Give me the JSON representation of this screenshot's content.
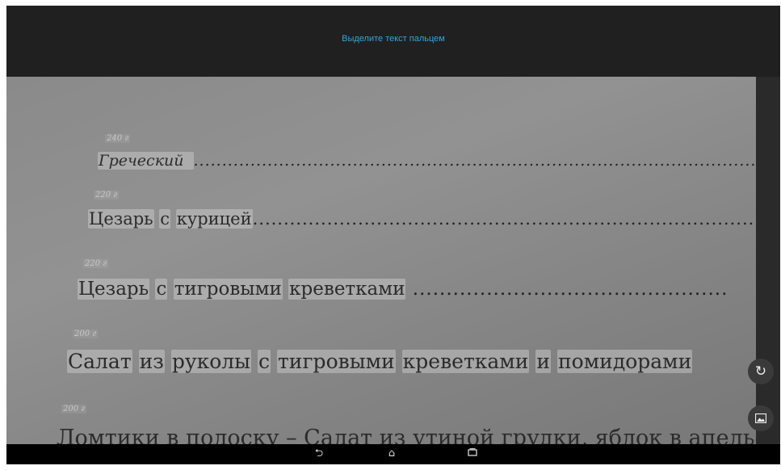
{
  "header": {
    "hint": "Выделите текст пальцем"
  },
  "menu": [
    {
      "price": "240 г",
      "words": [
        "Греческий"
      ]
    },
    {
      "price": "220 г",
      "words": [
        "Цезарь",
        "с",
        "курицей"
      ]
    },
    {
      "price": "220 г",
      "words": [
        "Цезарь",
        "с",
        "тигровыми",
        "креветками"
      ]
    },
    {
      "price": "200 г",
      "words": [
        "Салат",
        "из",
        "руколы",
        "с",
        "тигровыми",
        "креветками",
        "и",
        "помидорами"
      ]
    },
    {
      "price": "200 г",
      "words": [],
      "plain": "Ломтики в полоску – Салат из утиной грудки, яблок в апельсиновом"
    }
  ],
  "controls": {
    "rotate_icon": "rotate-icon",
    "gallery_icon": "gallery-icon"
  },
  "navbar": {
    "back_icon": "back-icon",
    "home_icon": "home-icon",
    "recents_icon": "recents-icon"
  }
}
